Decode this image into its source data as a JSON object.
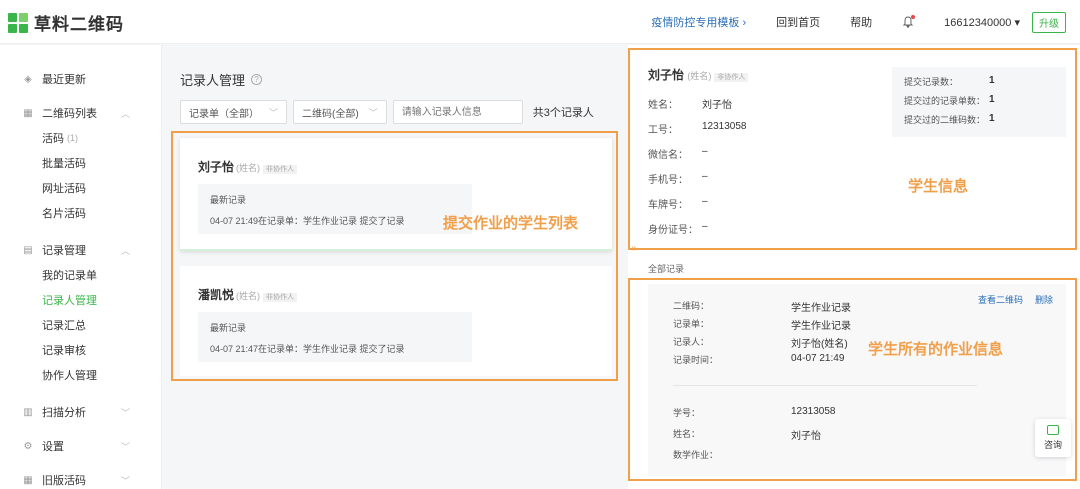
{
  "header": {
    "logo_text": "草料二维码",
    "nav": {
      "epidemic": "疫情防控专用模板 ›",
      "home": "回到首页",
      "help": "帮助",
      "user": "16612340000 ▾",
      "upgrade": "升级"
    }
  },
  "sidebar": {
    "recent": "最近更新",
    "qr_list": "二维码列表",
    "qr_items": [
      "活码",
      "批量活码",
      "网址活码",
      "名片活码"
    ],
    "qr_count": "(1)",
    "record_mgmt": "记录管理",
    "record_items": [
      "我的记录单",
      "记录人管理",
      "记录汇总",
      "记录审核",
      "协作人管理"
    ],
    "scan": "扫描分析",
    "settings": "设置",
    "old": "旧版活码"
  },
  "main": {
    "title": "记录人管理",
    "filter_form": "记录单（全部）",
    "filter_qr": "二维码(全部)",
    "search_placeholder": "请输入记录人信息",
    "count": "共3个记录人",
    "cards": [
      {
        "name": "刘子怡",
        "sub": "(姓名)",
        "tag": "非协作人",
        "label": "最新记录",
        "text": "04-07 21:49在记录单：学生作业记录 提交了记录"
      },
      {
        "name": "潘凯悦",
        "sub": "(姓名)",
        "tag": "非协作人",
        "label": "最新记录",
        "text": "04-07 21:47在记录单：学生作业记录 提交了记录"
      }
    ],
    "annotation": "提交作业的学生列表"
  },
  "detail": {
    "name": "刘子怡",
    "sub": "(姓名)",
    "tag": "非协作人",
    "fields": [
      {
        "k": "姓名：",
        "v": "刘子怡"
      },
      {
        "k": "工号：",
        "v": "12313058"
      },
      {
        "k": "微信名：",
        "v": "–"
      },
      {
        "k": "手机号：",
        "v": "–"
      },
      {
        "k": "车牌号：",
        "v": "–"
      },
      {
        "k": "身份证号：",
        "v": "–"
      }
    ],
    "stats": [
      {
        "k": "提交记录数：",
        "v": "1"
      },
      {
        "k": "提交过的记录单数：",
        "v": "1"
      },
      {
        "k": "提交过的二维码数：",
        "v": "1"
      }
    ],
    "annotation": "学生信息",
    "all_records": "全部记录",
    "record": {
      "links": [
        "查看二维码",
        "删除"
      ],
      "rows": [
        {
          "k": "二维码：",
          "v": "学生作业记录"
        },
        {
          "k": "记录单：",
          "v": "学生作业记录"
        },
        {
          "k": "记录人：",
          "v": "刘子怡(姓名)"
        },
        {
          "k": "记录时间：",
          "v": "04-07 21:49"
        }
      ],
      "rows2": [
        {
          "k": "学号：",
          "v": "12313058"
        },
        {
          "k": "姓名：",
          "v": "刘子怡"
        },
        {
          "k": "数学作业：",
          "v": ""
        }
      ]
    },
    "record_annotation": "学生所有的作业信息",
    "consult": "咨询"
  }
}
